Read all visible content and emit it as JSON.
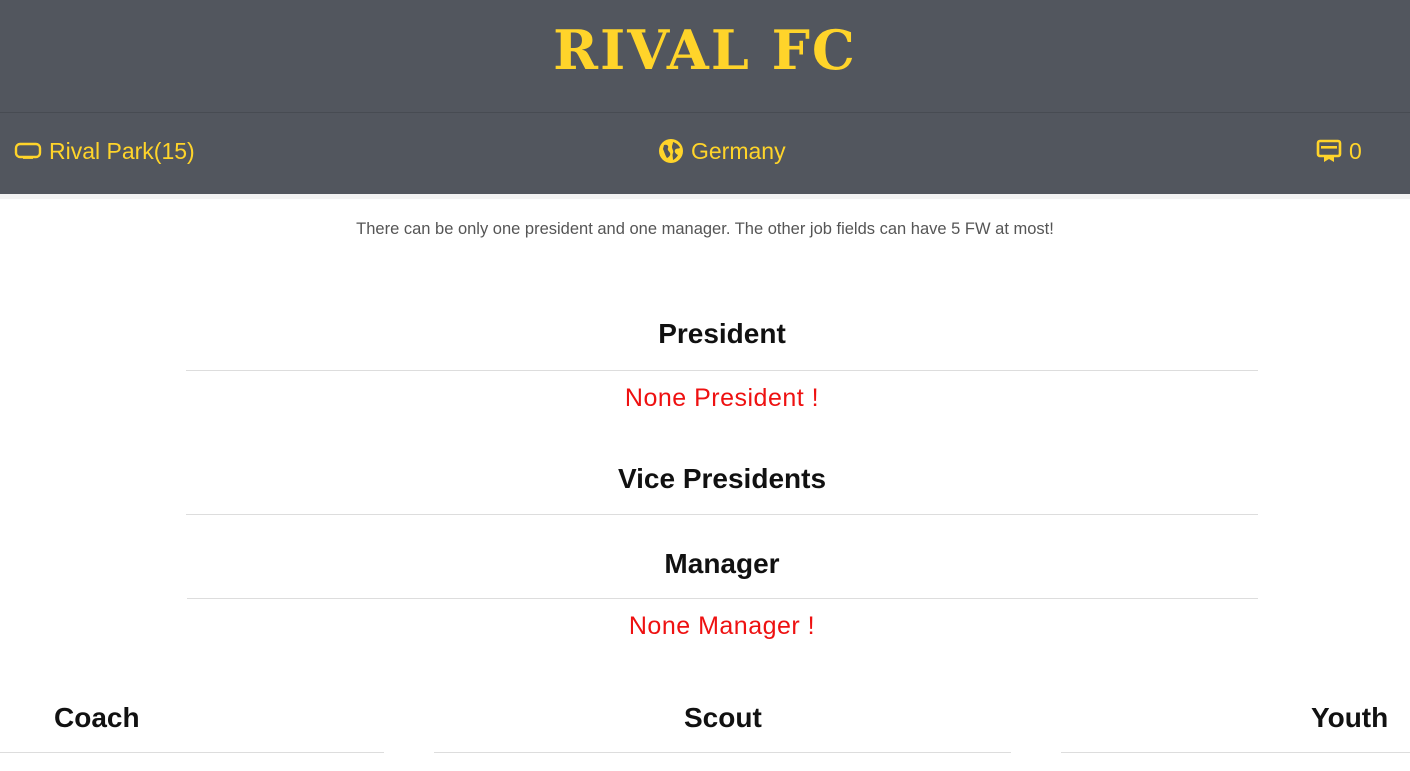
{
  "header": {
    "club_name": "RIVAL FC"
  },
  "infobar": {
    "stadium": "Rival Park(15)",
    "country": "Germany",
    "credits": "0"
  },
  "notice": "There can be only one president and one manager. The other job fields can have 5 FW at most!",
  "sections": {
    "president": {
      "title": "President",
      "empty_text": "None President !"
    },
    "vice_presidents": {
      "title": "Vice Presidents"
    },
    "manager": {
      "title": "Manager",
      "empty_text": "None Manager !"
    }
  },
  "columns": {
    "coach": "Coach",
    "scout": "Scout",
    "youth": "Youth"
  },
  "colors": {
    "header_bg": "#52565e",
    "accent": "#ffd42a",
    "vacant": "#ee1111"
  },
  "icons": {
    "stadium": "stadium-icon",
    "country": "globe-icon",
    "credits": "credits-icon"
  }
}
